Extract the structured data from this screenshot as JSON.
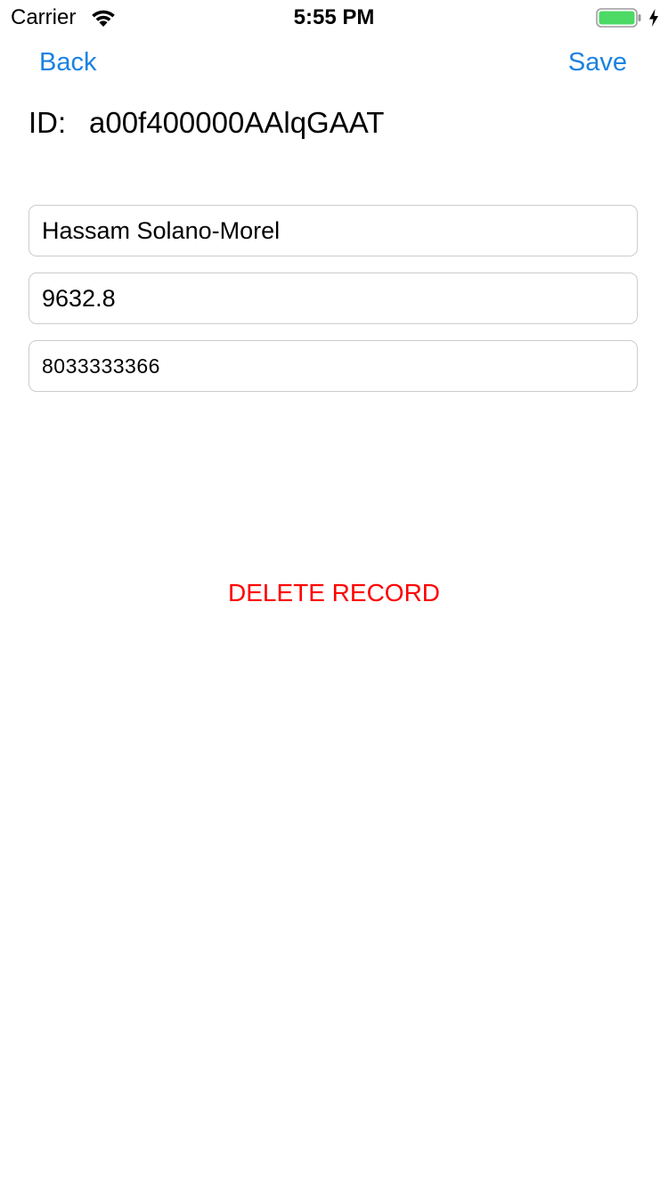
{
  "status_bar": {
    "carrier": "Carrier",
    "time": "5:55 PM",
    "icons": [
      "wifi-icon",
      "battery-icon",
      "charging-icon"
    ],
    "battery_color": "#4cd964"
  },
  "nav": {
    "back_label": "Back",
    "save_label": "Save",
    "accent_color": "#1a82e2"
  },
  "record": {
    "id_label": "ID:",
    "id_value": "a00f400000AAlqGAAT",
    "name": "Hassam Solano-Morel",
    "amount": "9632.8",
    "phone": "8033333366"
  },
  "actions": {
    "delete_label": "DELETE RECORD",
    "delete_color": "#ff0000"
  }
}
